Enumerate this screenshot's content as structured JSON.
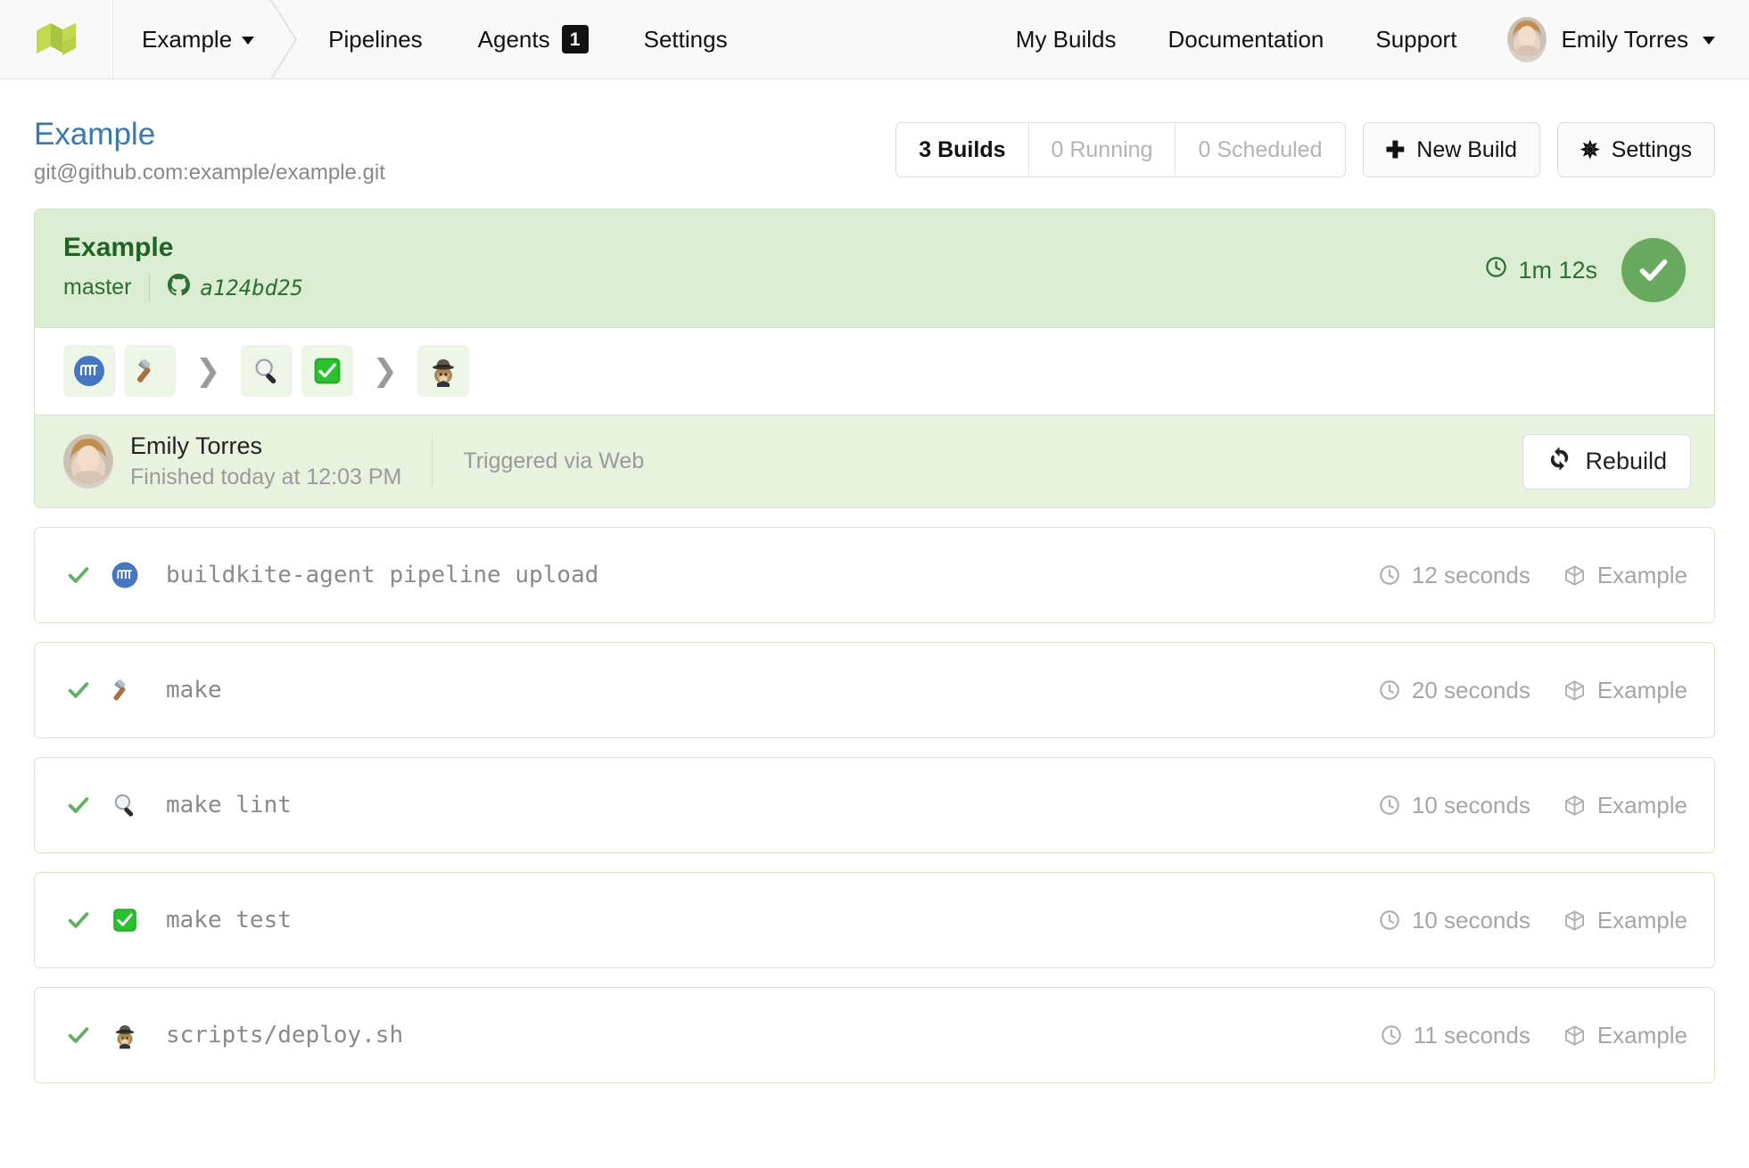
{
  "nav": {
    "logo_name": "buildkite-logo",
    "org": "Example",
    "links": [
      {
        "label": "Pipelines",
        "badge": null
      },
      {
        "label": "Agents",
        "badge": "1"
      },
      {
        "label": "Settings",
        "badge": null
      }
    ],
    "right_links": [
      {
        "label": "My Builds"
      },
      {
        "label": "Documentation"
      },
      {
        "label": "Support"
      }
    ],
    "user": "Emily Torres"
  },
  "pagehead": {
    "title": "Example",
    "repo": "git@github.com:example/example.git",
    "counts": [
      {
        "label": "3 Builds",
        "state": "active"
      },
      {
        "label": "0 Running",
        "state": "muted"
      },
      {
        "label": "0 Scheduled",
        "state": "muted"
      }
    ],
    "new_build_label": "New Build",
    "settings_label": "Settings"
  },
  "build": {
    "name": "Example",
    "branch": "master",
    "commit": "a124bd25",
    "duration": "1m 12s",
    "status": "passed",
    "steps": [
      {
        "icon": "buildkite-agent-icon",
        "group": 1
      },
      {
        "icon": "hammer-icon",
        "group": 1
      },
      {
        "icon": "magnifying-glass-icon",
        "group": 2
      },
      {
        "icon": "white-check-mark-icon",
        "group": 2
      },
      {
        "icon": "cat-in-hat-icon",
        "group": 3
      }
    ],
    "creator": "Emily Torres",
    "finished": "Finished today at 12:03 PM",
    "trigger": "Triggered via Web",
    "rebuild_label": "Rebuild"
  },
  "jobs": [
    {
      "state": "passed",
      "icon": "buildkite-agent-icon",
      "label": "buildkite-agent pipeline upload",
      "duration": "12 seconds",
      "agent": "Example"
    },
    {
      "state": "passed",
      "icon": "hammer-icon",
      "label": "make",
      "duration": "20 seconds",
      "agent": "Example"
    },
    {
      "state": "passed",
      "icon": "magnifying-glass-icon",
      "label": "make lint",
      "duration": "10 seconds",
      "agent": "Example"
    },
    {
      "state": "passed",
      "icon": "white-check-mark-icon",
      "label": "make test",
      "duration": "10 seconds",
      "agent": "Example"
    },
    {
      "state": "passed",
      "icon": "cat-in-hat-icon",
      "label": "scripts/deploy.sh",
      "duration": "11 seconds",
      "agent": "Example"
    }
  ],
  "colors": {
    "brand_green": "#b0ce4a",
    "link_blue": "#337ab7",
    "pass_green": "#67a95f",
    "card_header_bg": "#dbedd0",
    "card_footer_bg": "#e7f2df",
    "card_border": "#cfe3c4",
    "muted_text": "#9a9a9a"
  }
}
